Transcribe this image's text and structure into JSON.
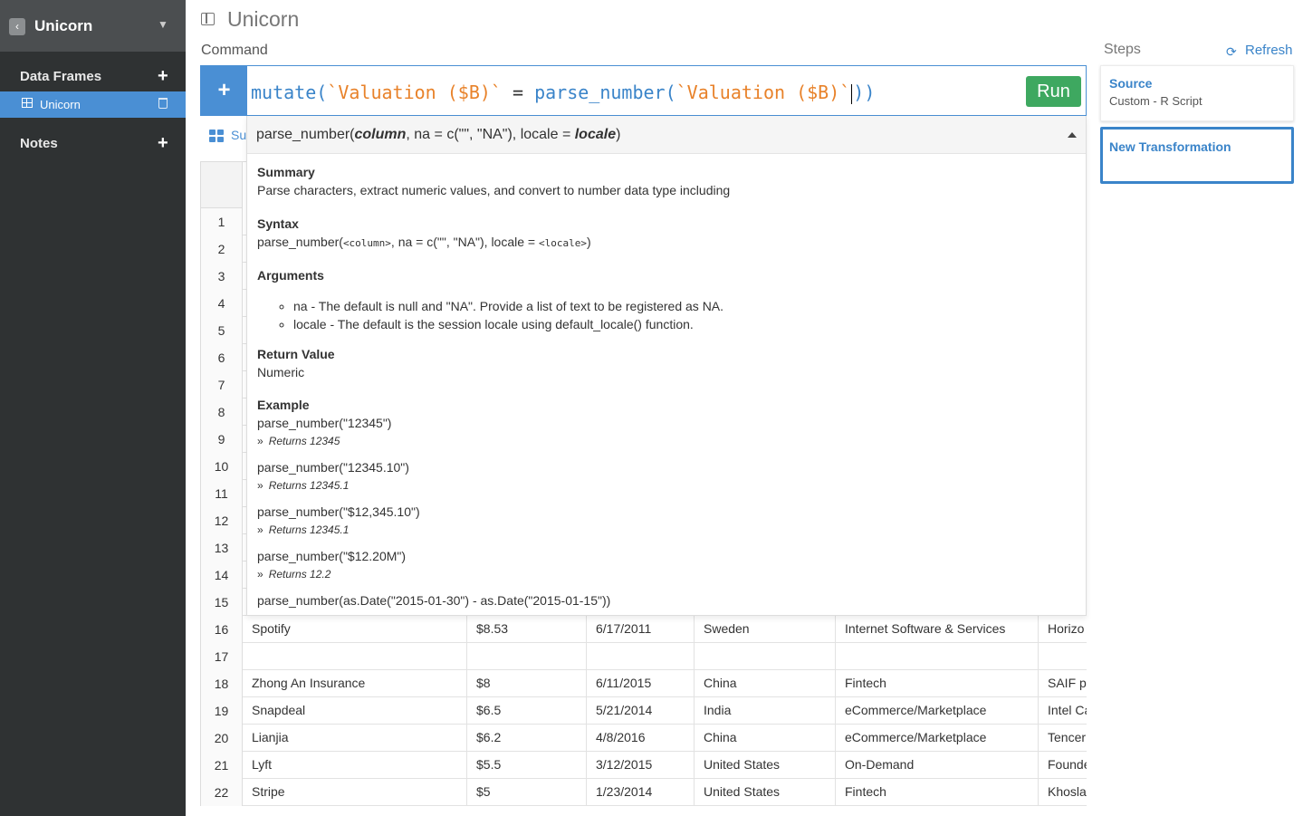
{
  "sidebar": {
    "back_icon": "‹",
    "title": "Unicorn",
    "chevron": "⌄",
    "data_frames_label": "Data Frames",
    "data_frame_item": "Unicorn",
    "notes_label": "Notes",
    "plus": "+"
  },
  "header": {
    "title": "Unicorn",
    "command_label": "Command",
    "steps_label": "Steps",
    "refresh_label": "Refresh",
    "refresh_icon": "⟳"
  },
  "command": {
    "add_icon": "+",
    "tokens": {
      "fn1": "mutate",
      "p1": "(",
      "str1": "`Valuation ($B)`",
      "eq": " = ",
      "fn2": "parse_number",
      "p2": "(",
      "str2": "`Valuation ($B)`",
      "p3": "))"
    },
    "run_label": "Run"
  },
  "summary_tab": "Su",
  "help": {
    "signature": {
      "fn": "parse_number(",
      "arg1": "column",
      "mid": ", na = c(\"\", \"NA\"), locale = ",
      "arg2": "locale",
      "end": ")"
    },
    "summary_title": "Summary",
    "summary_text": "Parse characters, extract numeric values, and convert to number data type including",
    "syntax_title": "Syntax",
    "syntax_pre": "parse_number(",
    "syntax_col": "<column>",
    "syntax_mid": ", na = c(\"\", \"NA\"), locale = ",
    "syntax_loc": "<locale>",
    "syntax_end": ")",
    "arguments_title": "Arguments",
    "arguments": [
      "na - The default is null and \"NA\". Provide a list of text to be registered as NA.",
      "locale - The default is the session locale using default_locale() function."
    ],
    "return_title": "Return Value",
    "return_text": "Numeric",
    "example_title": "Example",
    "examples": [
      {
        "code": "parse_number(\"12345\")",
        "ret": "Returns 12345"
      },
      {
        "code": "parse_number(\"12345.10\")",
        "ret": "Returns 12345.1"
      },
      {
        "code": "parse_number(\"$12,345.10\")",
        "ret": "Returns 12345.1"
      },
      {
        "code": "parse_number(\"$12.20M\")",
        "ret": "Returns 12.2"
      },
      {
        "code": "parse_number(as.Date(\"2015-01-30\") - as.Date(\"2015-01-15\"))",
        "ret": ""
      }
    ],
    "ret_arrow": "»"
  },
  "table": {
    "row_numbers": [
      "1",
      "2",
      "3",
      "4",
      "5",
      "6",
      "7",
      "8",
      "9",
      "10",
      "11",
      "12",
      "13",
      "14",
      "15"
    ],
    "rows": [
      {
        "num": "16",
        "cells": [
          "Spotify",
          "$8.53",
          "6/17/2011",
          "Sweden",
          "Internet Software & Services",
          "Horizo"
        ]
      },
      {
        "num": "17",
        "cells": [
          "",
          "",
          "",
          "",
          "",
          ""
        ]
      },
      {
        "num": "18",
        "cells": [
          "Zhong An Insurance",
          "$8",
          "6/11/2015",
          "China",
          "Fintech",
          "SAIF p"
        ]
      },
      {
        "num": "19",
        "cells": [
          "Snapdeal",
          "$6.5",
          "5/21/2014",
          "India",
          "eCommerce/Marketplace",
          "Intel Ca"
        ]
      },
      {
        "num": "20",
        "cells": [
          "Lianjia",
          "$6.2",
          "4/8/2016",
          "China",
          "eCommerce/Marketplace",
          "Tencer"
        ]
      },
      {
        "num": "21",
        "cells": [
          "Lyft",
          "$5.5",
          "3/12/2015",
          "United States",
          "On-Demand",
          "Founde"
        ]
      },
      {
        "num": "22",
        "cells": [
          "Stripe",
          "$5",
          "1/23/2014",
          "United States",
          "Fintech",
          "Khosla"
        ]
      }
    ]
  },
  "steps": {
    "source_title": "Source",
    "source_sub": "Custom - R Script",
    "new_title": "New Transformation"
  },
  "colors": {
    "accent": "#4a8fd4",
    "run": "#3ea860",
    "string": "#e8822a",
    "function": "#3a84c9"
  }
}
